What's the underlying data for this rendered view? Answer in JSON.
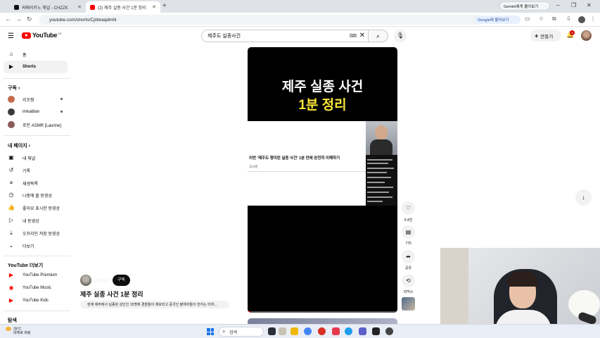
{
  "browser": {
    "tabs": [
      {
        "title": "싸패리카노 채널 - CHZZK",
        "active": false,
        "favicon_color": "#111111"
      },
      {
        "title": "(2) 제주 실종 사건 1분 정리",
        "active": true,
        "favicon_color": "#ff0000"
      }
    ],
    "new_tab_symbol": "+",
    "gemini_label": "Gemini에게 물어보기",
    "url": "youtube.com/shorts/Cjnbraqdmhl",
    "google_translate_label": "Google에 물어보기"
  },
  "masthead": {
    "logo_text": "YouTube",
    "logo_region": "KR",
    "search_value": "제주도 실종사건",
    "create_label": "만들기",
    "notification_count": "2"
  },
  "sidebar": {
    "main": [
      {
        "label": "홈",
        "icon": "home-icon"
      },
      {
        "label": "Shorts",
        "icon": "shorts-icon",
        "active": true
      }
    ],
    "subscriptions_header": "구독",
    "subscriptions": [
      {
        "label": "리꼬짱",
        "color": "#c46b4e",
        "dot": true
      },
      {
        "label": "imkablan",
        "color": "#3a3a3a",
        "dot": true
      },
      {
        "label": "로린 ASMR [Laurine]",
        "color": "#8a5a5a",
        "dot": false
      }
    ],
    "my_page_header": "내 페이지",
    "my_page": [
      {
        "label": "내 채널",
        "icon": "channel-icon"
      },
      {
        "label": "기록",
        "icon": "history-icon"
      },
      {
        "label": "재생목록",
        "icon": "playlist-icon"
      },
      {
        "label": "나중에 볼 동영상",
        "icon": "watch-later-icon"
      },
      {
        "label": "좋아요 표시한 동영상",
        "icon": "like-icon"
      },
      {
        "label": "내 동영상",
        "icon": "my-videos-icon"
      },
      {
        "label": "오프라인 저장 동영상",
        "icon": "download-icon"
      },
      {
        "label": "더보기",
        "icon": "chevron-down-icon"
      }
    ],
    "more_header": "YouTube 더보기",
    "more": [
      {
        "label": "YouTube Premium"
      },
      {
        "label": "YouTube Music"
      },
      {
        "label": "YouTube Kids"
      }
    ],
    "explore_header": "탐색"
  },
  "short": {
    "overlay_title_line1": "제주 실종 사건",
    "overlay_title_line2": "1분 정리",
    "clip_caption": "이번 '제주도 쟁미린 실종 사건' 1분 만에 완전히 이해하기",
    "clip_sub": "고시천",
    "progress": 0.02,
    "channel_handle": "@김종표",
    "subscribe_label": "구독",
    "title": "제주 실종 사건 1분 정리",
    "description": "현재 제주에서 실종된 성인인 15명에 경찰들이 체포되고 중국인 불체자들이 한지는 미처..."
  },
  "actions": [
    {
      "name": "like",
      "icon": "thumb-up-icon",
      "label": "5.4천"
    },
    {
      "name": "comments",
      "icon": "comment-icon",
      "label": "775"
    },
    {
      "name": "share",
      "icon": "share-icon",
      "label": "공유"
    },
    {
      "name": "remix",
      "icon": "remix-icon",
      "label": "리믹스"
    }
  ],
  "taskbar": {
    "weather_temp": "26°C",
    "weather_desc": "대체로 흐림",
    "search_placeholder": "검색"
  },
  "colors": {
    "youtube_red": "#ff0000",
    "overlay_yellow": "#ffe83a",
    "chip_gray": "#f2f2f2"
  }
}
